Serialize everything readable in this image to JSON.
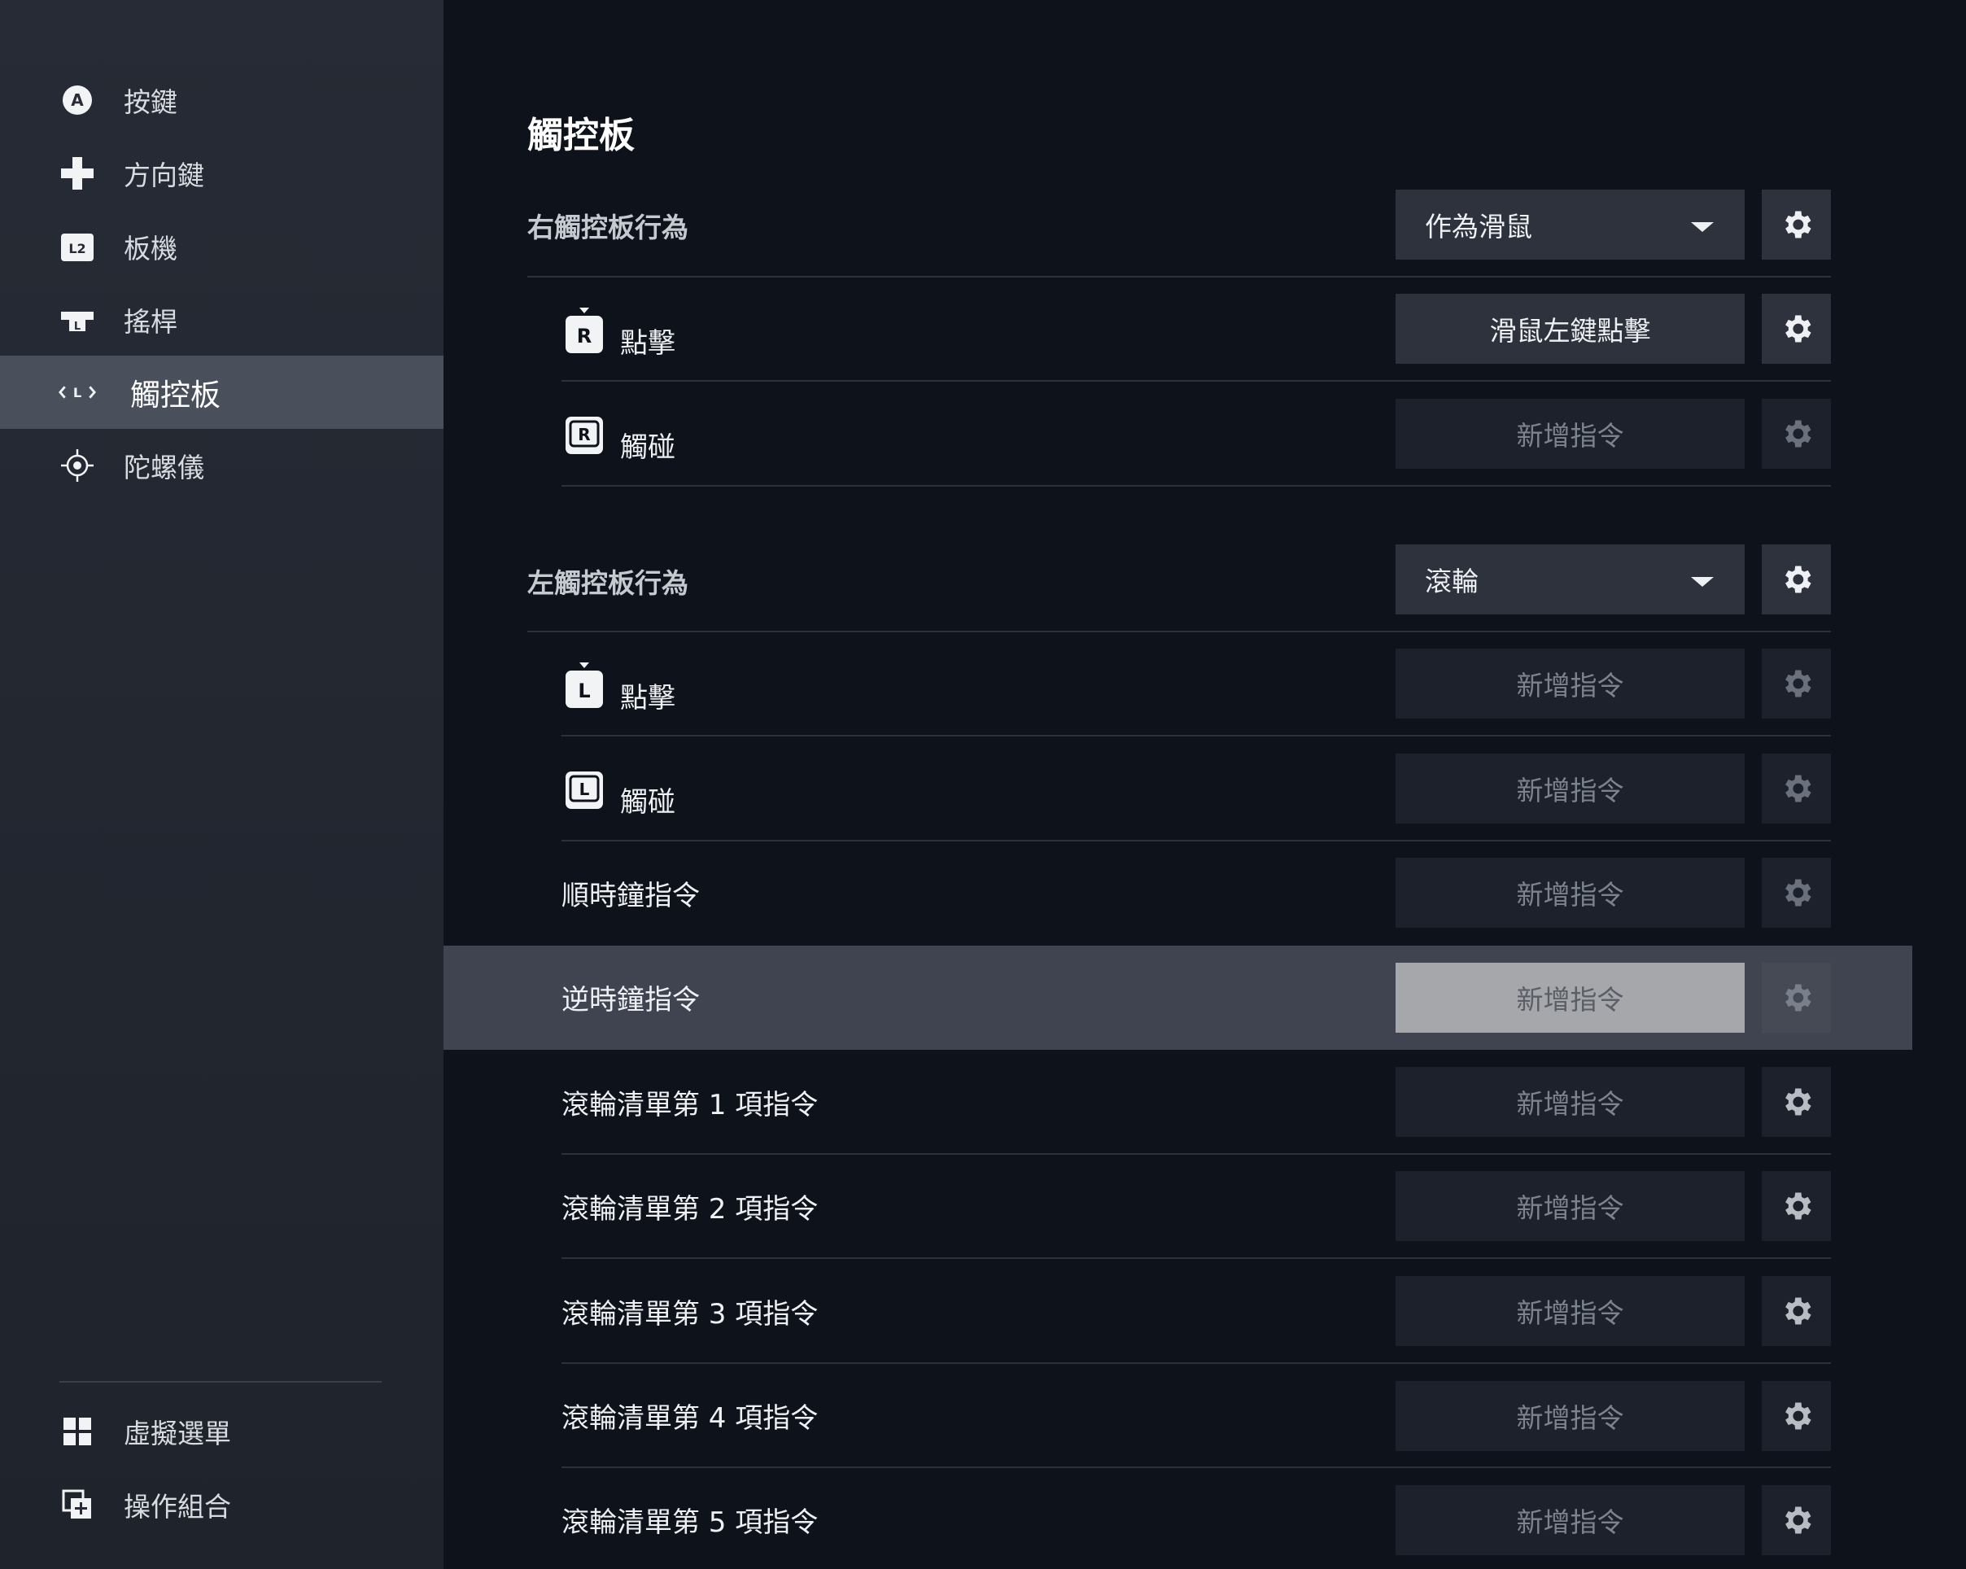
{
  "sidebar": {
    "items": [
      {
        "label": "按鍵",
        "icon": "a-button-icon"
      },
      {
        "label": "方向鍵",
        "icon": "dpad-icon"
      },
      {
        "label": "板機",
        "icon": "l2-trigger-icon"
      },
      {
        "label": "搖桿",
        "icon": "joystick-icon"
      },
      {
        "label": "觸控板",
        "icon": "trackpad-icon",
        "active": true
      },
      {
        "label": "陀螺儀",
        "icon": "gyro-icon"
      }
    ],
    "bottom_items": [
      {
        "label": "虛擬選單",
        "icon": "grid-menu-icon"
      },
      {
        "label": "操作組合",
        "icon": "action-set-icon"
      }
    ]
  },
  "main": {
    "title": "觸控板",
    "right_pad": {
      "section_title": "右觸控板行為",
      "mode_value": "作為滑鼠",
      "rows": [
        {
          "label": "點擊",
          "glyph": "R",
          "command": "滑鼠左鍵點擊"
        },
        {
          "label": "觸碰",
          "glyph": "R",
          "command": "新增指令"
        }
      ]
    },
    "left_pad": {
      "section_title": "左觸控板行為",
      "mode_value": "滾輪",
      "rows": [
        {
          "label": "點擊",
          "glyph": "L",
          "command": "新增指令"
        },
        {
          "label": "觸碰",
          "glyph": "L",
          "command": "新增指令"
        },
        {
          "label": "順時鐘指令",
          "command": "新增指令"
        },
        {
          "label": "逆時鐘指令",
          "command": "新增指令"
        },
        {
          "label": "滾輪清單第 1 項指令",
          "command": "新增指令"
        },
        {
          "label": "滾輪清單第 2 項指令",
          "command": "新增指令"
        },
        {
          "label": "滾輪清單第 3 項指令",
          "command": "新增指令"
        },
        {
          "label": "滾輪清單第 4 項指令",
          "command": "新增指令"
        },
        {
          "label": "滾輪清單第 5 項指令",
          "command": "新增指令"
        }
      ]
    }
  },
  "colors": {
    "sidebar_bg": "#262b35",
    "sidebar_active": "#494f5b",
    "main_bg": "#0e121a",
    "button_bg": "#1c212b",
    "button_filled_bg": "#2d323c",
    "button_focused_bg": "#a5a7ab",
    "row_highlight": "#3f4450"
  }
}
